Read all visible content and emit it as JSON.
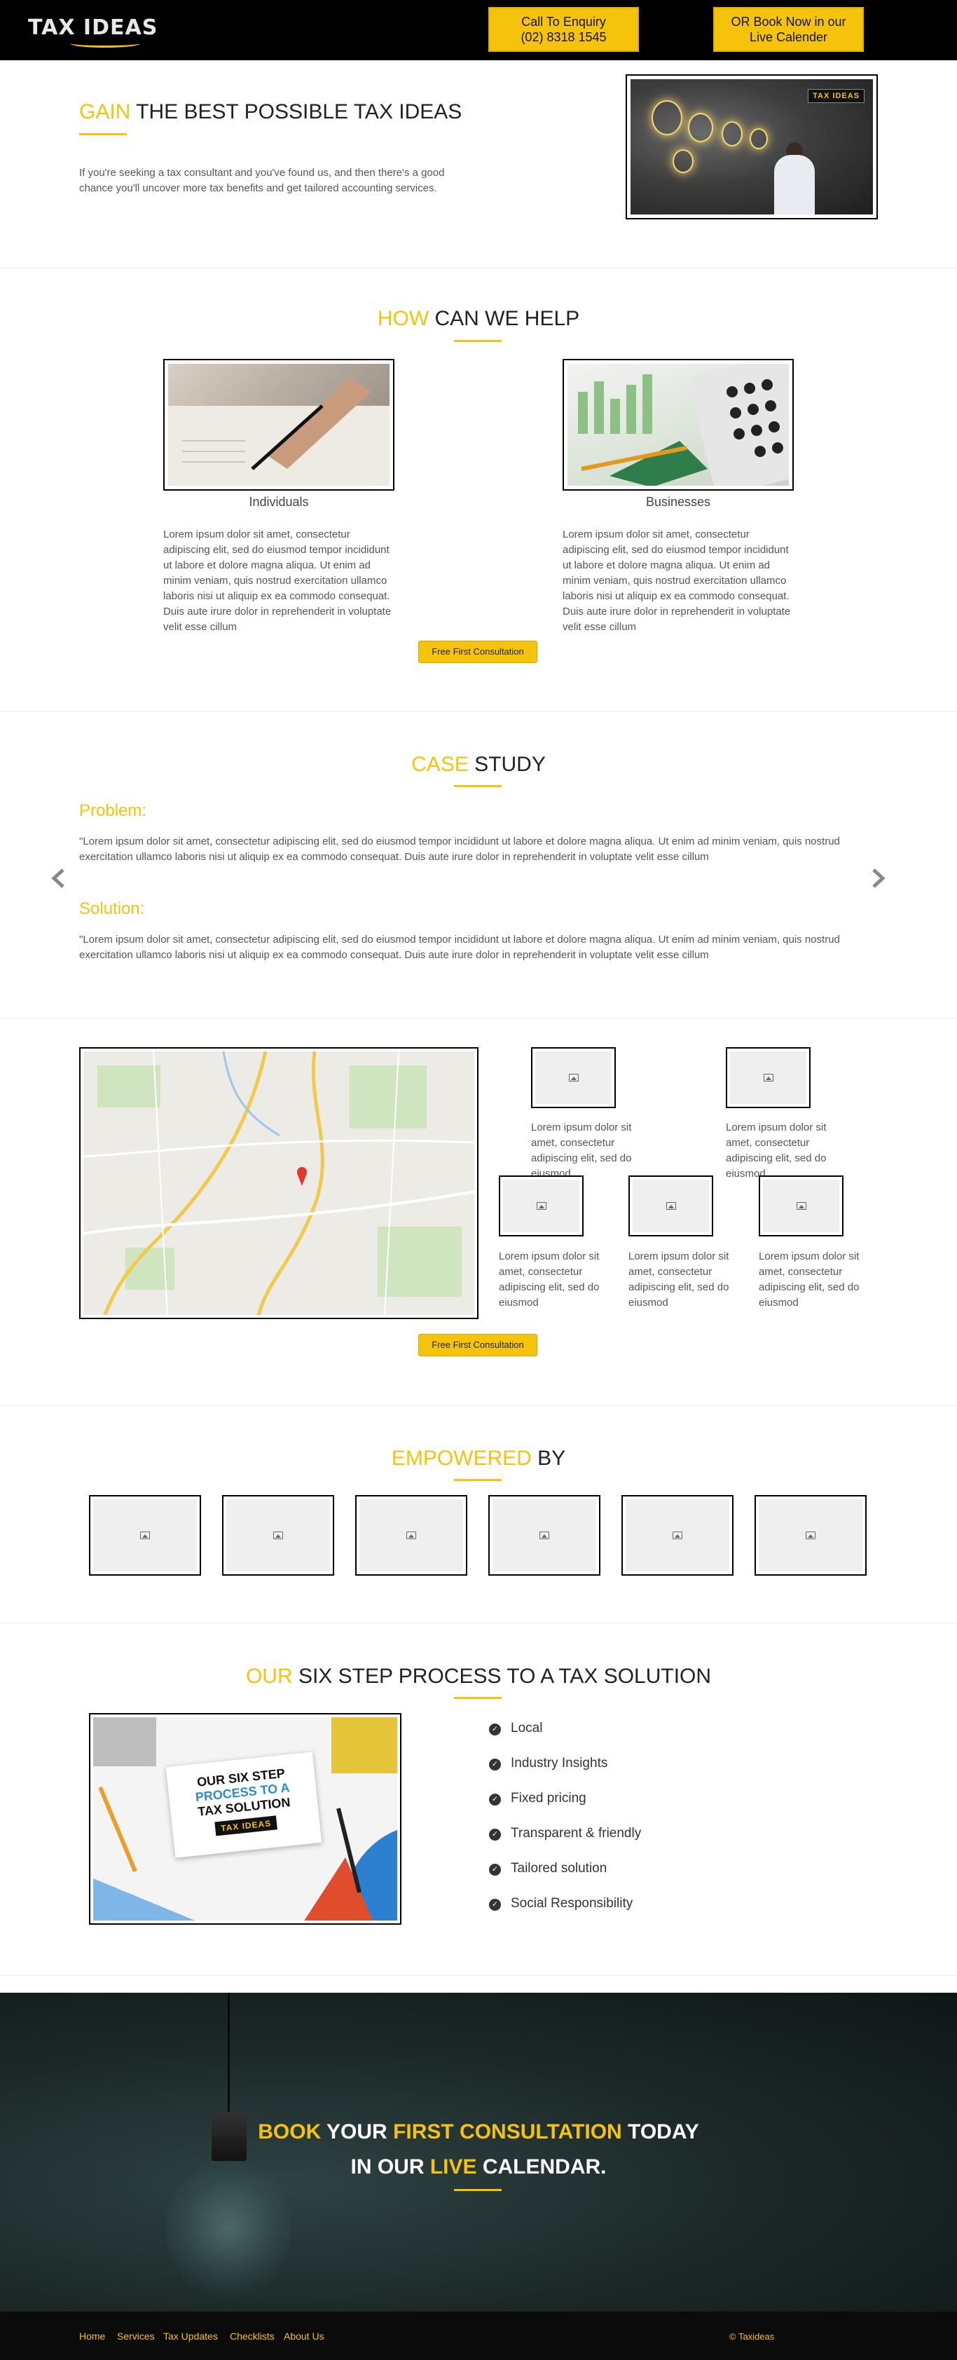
{
  "header": {
    "logo_text": "TAX IDEAS",
    "call_btn_line1": "Call To Enquiry",
    "call_btn_line2": "(02) 8318 1545",
    "book_btn_line1": "OR Book Now in our",
    "book_btn_line2": "Live Calender"
  },
  "hero": {
    "title_accent": "GAIN",
    "title_rest": " THE BEST POSSIBLE TAX IDEAS",
    "text": "If you're seeking a tax consultant and you've found us, and then there's a good chance you'll uncover more tax benefits and get tailored accounting services.",
    "image_badge": "TAX IDEAS"
  },
  "help": {
    "title_accent": "HOW",
    "title_rest": " CAN WE HELP",
    "cards": [
      {
        "caption": "Individuals",
        "text": "Lorem ipsum dolor sit amet, consectetur adipiscing elit, sed do eiusmod tempor incididunt ut labore et dolore magna aliqua. Ut enim ad minim veniam, quis nostrud exercitation ullamco laboris nisi ut aliquip ex ea commodo consequat. Duis aute irure dolor in reprehenderit in voluptate velit esse cillum"
      },
      {
        "caption": "Businesses",
        "text": "Lorem ipsum dolor sit amet, consectetur adipiscing elit, sed do eiusmod tempor incididunt ut labore et dolore magna aliqua. Ut enim ad minim veniam, quis nostrud exercitation ullamco laboris nisi ut aliquip ex ea commodo consequat. Duis aute irure dolor in reprehenderit in voluptate velit esse cillum"
      }
    ],
    "button": "Free First Consultation"
  },
  "case_study": {
    "title_accent": "CASE",
    "title_rest": " STUDY",
    "problem_label": "Problem:",
    "problem_text": "\"Lorem ipsum dolor sit amet, consectetur adipiscing elit, sed do eiusmod tempor incididunt ut labore et dolore magna aliqua. Ut enim ad minim veniam, quis nostrud exercitation ullamco laboris nisi ut aliquip ex ea commodo consequat. Duis aute irure dolor in reprehenderit in voluptate velit esse cillum",
    "solution_label": "Solution:",
    "solution_text": "\"Lorem ipsum dolor sit amet, consectetur adipiscing elit, sed do eiusmod tempor incididunt ut labore et dolore magna aliqua. Ut enim ad minim veniam, quis nostrud exercitation ullamco laboris nisi ut aliquip ex ea commodo consequat. Duis aute irure dolor in reprehenderit in voluptate velit esse cillum",
    "prev_icon": "chevron-left-icon",
    "next_icon": "chevron-right-icon"
  },
  "features": {
    "items": [
      {
        "text": "Lorem ipsum dolor sit amet, consectetur adipiscing elit, sed do eiusmod"
      },
      {
        "text": "Lorem ipsum dolor sit amet, consectetur adipiscing elit, sed do eiusmod"
      },
      {
        "text": "Lorem ipsum dolor sit amet, consectetur adipiscing elit, sed do eiusmod"
      },
      {
        "text": "Lorem ipsum dolor sit amet, consectetur adipiscing elit, sed do eiusmod"
      },
      {
        "text": "Lorem ipsum dolor sit amet, consectetur adipiscing elit, sed do eiusmod"
      }
    ],
    "button": "Free First Consultation"
  },
  "empowered": {
    "title_accent": "EMPOWERED",
    "title_rest": " BY",
    "logo_count_icon": "image-placeholder-icon"
  },
  "six_step": {
    "title_accent": "OUR",
    "title_rest": " SIX STEP PROCESS TO A TAX SOLUTION",
    "card_line1": "OUR SIX STEP",
    "card_line2": "PROCESS TO A",
    "card_line3": "TAX SOLUTION",
    "card_badge": "TAX IDEAS",
    "steps": [
      "Local",
      "Industry Insights",
      "Fixed pricing",
      "Transparent & friendly",
      "Tailored solution",
      "Social Responsibility"
    ]
  },
  "cta": {
    "w1": "BOOK",
    "w2": " YOUR ",
    "w3": "FIRST CONSULTATION",
    "w4": " TODAY",
    "w5": "IN OUR ",
    "w6": "LIVE",
    "w7": " CALENDAR."
  },
  "footer": {
    "nav": [
      "Home",
      "Services",
      "Tax Updates",
      "Checklists",
      "About Us"
    ],
    "copyright": "© Taxideas"
  },
  "colors": {
    "accent": "#f5c30c",
    "header_bg": "#000000",
    "footer_bg": "#0b0b0b"
  }
}
